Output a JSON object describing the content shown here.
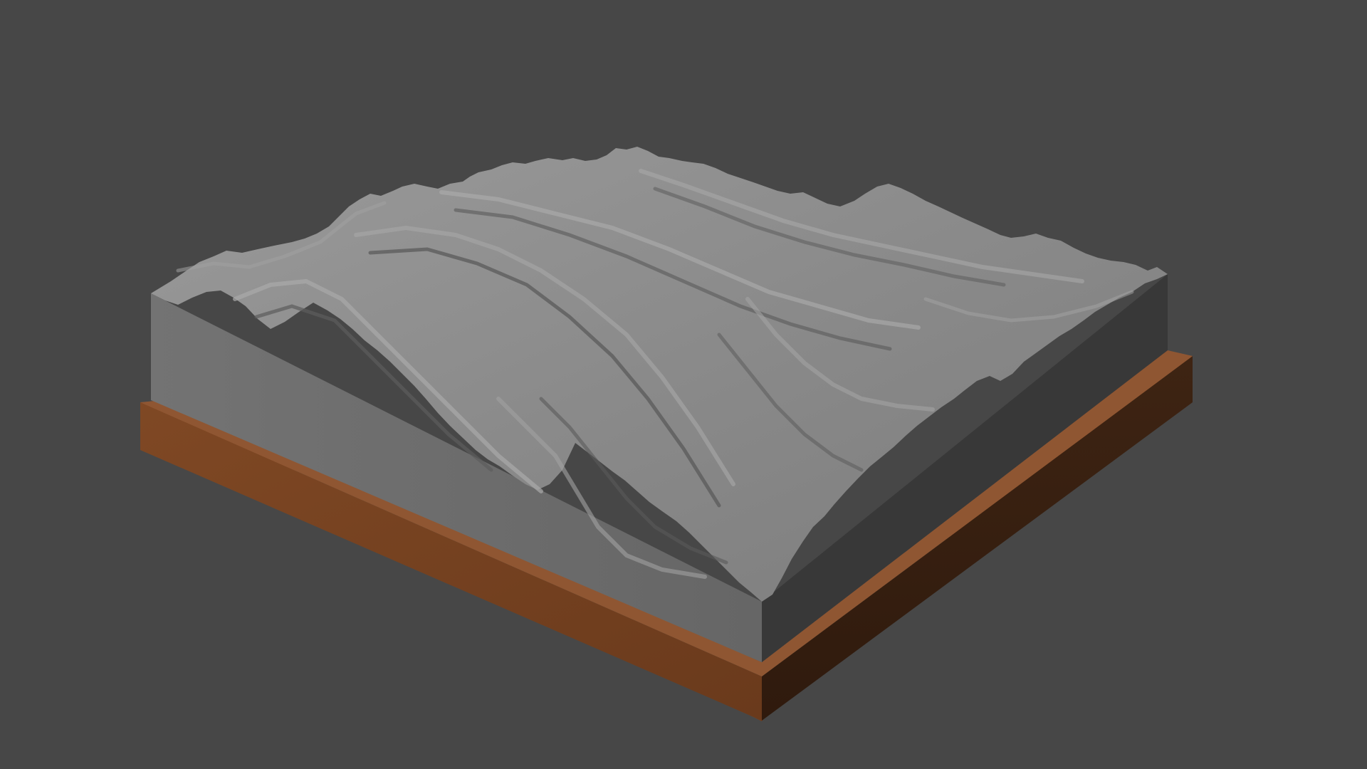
{
  "viewport": {
    "background_color": "#474747"
  },
  "model": {
    "base_color": "#7A4423",
    "block_front_color": "#6B6B6B",
    "block_side_color": "#383838",
    "terrain_color": "#8C8C8C",
    "terrain_highlight_color": "#A3A3A3",
    "terrain_shadow_color": "#5A5A5A"
  }
}
